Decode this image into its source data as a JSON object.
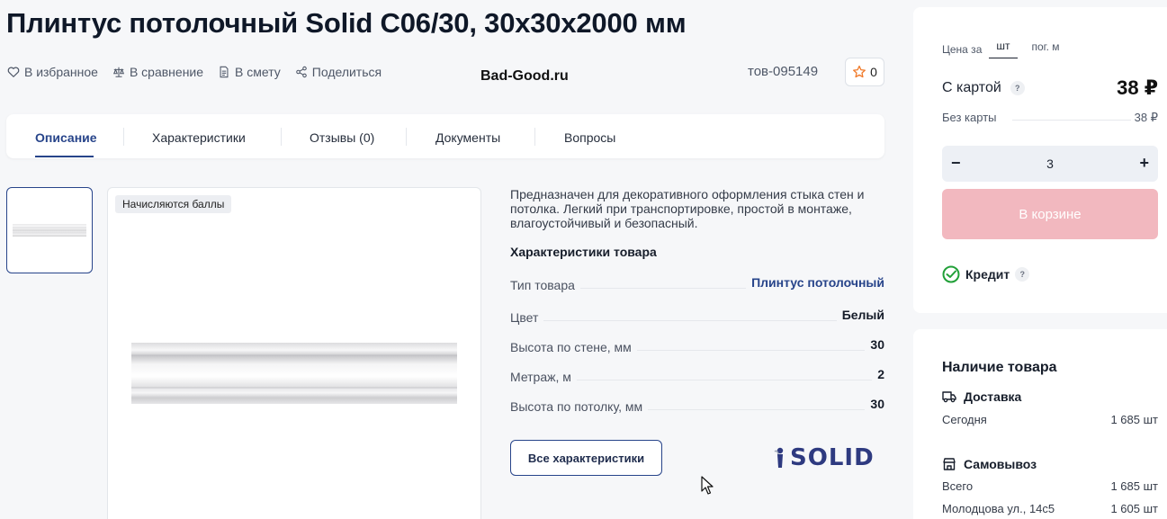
{
  "product": {
    "title": "Плинтус потолочный Solid C06/30, 30x30x2000 мм",
    "sku": "тов-095149",
    "fav_count": "0",
    "watermark": "Bad-Good.ru"
  },
  "actions": [
    {
      "label": "В избранное",
      "icon": "heart-icon"
    },
    {
      "label": "В сравнение",
      "icon": "scales-icon"
    },
    {
      "label": "В смету",
      "icon": "document-icon"
    },
    {
      "label": "Поделиться",
      "icon": "share-icon"
    }
  ],
  "tabs": [
    "Описание",
    "Характеристики",
    "Отзывы (0)",
    "Документы",
    "Вопросы"
  ],
  "image": {
    "badge": "Начисляются баллы"
  },
  "description": "Предназначен для декоративного оформления стыка стен и потолка. Легкий при транспортировке, простой в монтаже, влагоустойчивый и безопасный.",
  "specs": {
    "title": "Характеристики товара",
    "rows": [
      {
        "label": "Тип товара",
        "value": "Плинтус потолочный"
      },
      {
        "label": "Цвет",
        "value": "Белый"
      },
      {
        "label": "Высота по стене, мм",
        "value": "30"
      },
      {
        "label": "Метраж, м",
        "value": "2"
      },
      {
        "label": "Высота по потолку, мм",
        "value": "30"
      }
    ],
    "all_button": "Все характеристики",
    "brand": "SOLID"
  },
  "buy": {
    "price_for": "Цена за",
    "units": [
      "шт",
      "пог. м"
    ],
    "with_card_label": "С картой",
    "with_card_price": "38 ₽",
    "without_card_label": "Без карты",
    "without_card_price": "38 ₽",
    "qty": "3",
    "minus": "−",
    "plus": "+",
    "cart_button": "В корзине",
    "credit": "Кредит",
    "help": "?"
  },
  "availability": {
    "title": "Наличие товара",
    "delivery": {
      "label": "Доставка",
      "row_label": "Сегодня",
      "row_value": "1 685 шт"
    },
    "pickup": {
      "label": "Самовывоз",
      "rows": [
        {
          "label": "Всего",
          "value": "1 685 шт"
        },
        {
          "label": "Молодцова ул., 14с5",
          "value": "1 605 шт"
        }
      ]
    }
  },
  "colors": {
    "accent": "#27448a",
    "cart_button": "#f2b8bf",
    "fav_star": "#f07a2a",
    "credit_green": "#21a038"
  }
}
